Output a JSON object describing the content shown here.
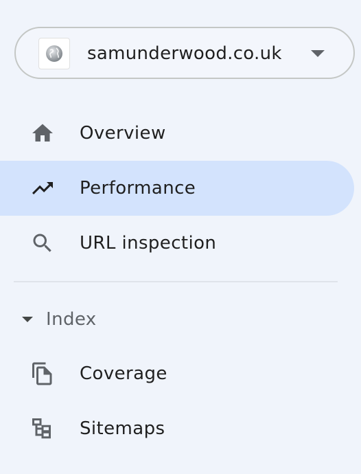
{
  "property": {
    "name": "samunderwood.co.uk",
    "favicon": "globe-icon"
  },
  "nav": {
    "items": [
      {
        "label": "Overview",
        "icon": "home-icon",
        "active": false
      },
      {
        "label": "Performance",
        "icon": "trending-up-icon",
        "active": true
      },
      {
        "label": "URL inspection",
        "icon": "search-icon",
        "active": false
      }
    ]
  },
  "index_section": {
    "label": "Index",
    "expanded": true,
    "items": [
      {
        "label": "Coverage",
        "icon": "coverage-icon"
      },
      {
        "label": "Sitemaps",
        "icon": "sitemap-icon"
      }
    ]
  },
  "colors": {
    "background": "#f0f4fb",
    "active_highlight": "#d3e3fd",
    "icon": "#5f6368",
    "text": "#1f1f1f"
  }
}
